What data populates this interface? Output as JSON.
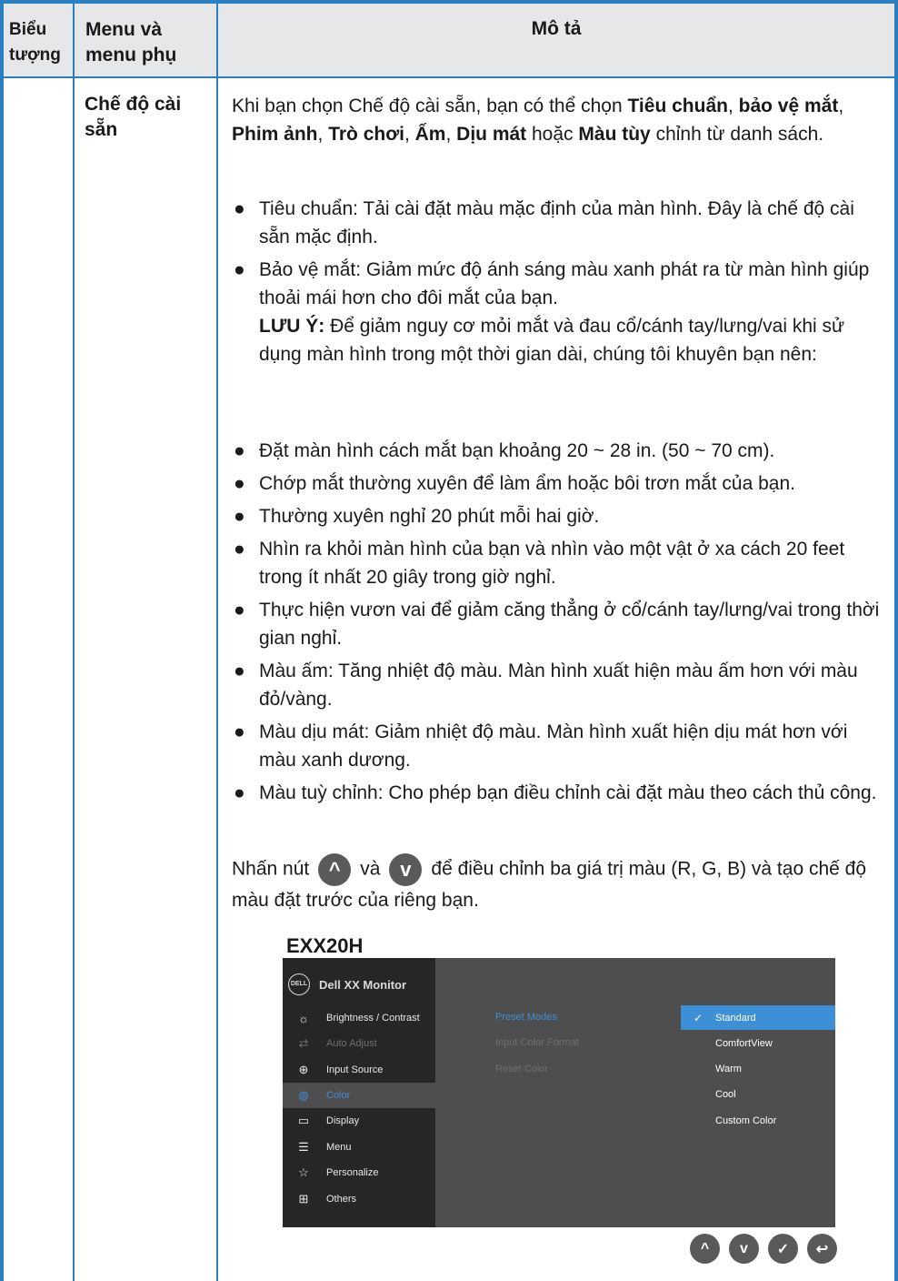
{
  "header": {
    "icon_col": "Biểu tượng",
    "menu_col": "Menu và menu phụ",
    "desc_col": "Mô tả"
  },
  "row": {
    "menu_name": "Chế độ cài sẵn",
    "intro": {
      "p1": "Khi bạn chọn Chế độ cài sẵn, bạn có thể chọn ",
      "b1": "Tiêu chuẩn",
      "p2": ", ",
      "b2": "bảo vệ mắt",
      "p3": ", ",
      "b3": "Phim ảnh",
      "p4": ", ",
      "b4": "Trò chơi",
      "p5": ", ",
      "b5": "Ấm",
      "p6": ", ",
      "b6": "Dịu mát",
      "p7": " hoặc ",
      "b7": "Màu tùy",
      "p8": " chỉnh từ danh sách."
    },
    "bullets_a": [
      "Tiêu chuẩn: Tải cài đặt màu mặc định của màn hình. Đây là chế độ cài sẵn mặc định.",
      "Bảo vệ mắt: Giảm mức độ ánh sáng màu xanh phát ra từ màn hình giúp thoải mái hơn cho đôi mắt của bạn."
    ],
    "note_label": "LƯU Ý:",
    "note_text": " Để giảm nguy cơ mỏi mắt và đau cổ/cánh tay/lưng/vai khi sử dụng màn hình trong một thời gian dài, chúng tôi khuyên bạn nên:",
    "bullets_b": [
      "Đặt màn hình cách mắt bạn khoảng 20 ~ 28 in. (50 ~ 70 cm).",
      "Chớp mắt thường xuyên để làm ẩm hoặc bôi trơn mắt của bạn.",
      "Thường xuyên nghỉ 20 phút mỗi hai giờ.",
      "Nhìn ra khỏi màn hình của bạn và nhìn vào một vật ở xa cách 20 feet trong ít nhất 20 giây trong giờ nghỉ.",
      "Thực hiện vươn vai để giảm căng thẳng ở cổ/cánh tay/lưng/vai trong thời gian nghỉ.",
      "Màu ấm: Tăng nhiệt độ màu. Màn hình xuất hiện màu ấm hơn với màu đỏ/vàng.",
      "Màu dịu mát: Giảm nhiệt độ màu. Màn hình xuất hiện dịu mát hơn với màu xanh dương.",
      "Màu tuỳ chỉnh: Cho phép bạn điều chỉnh cài đặt màu theo cách thủ công."
    ],
    "press": {
      "before": "Nhấn nút",
      "mid": "và",
      "after": "để điều chỉnh ba giá trị màu (R, G, B) và tạo chế độ màu đặt trước của riêng bạn."
    }
  },
  "osd": {
    "model": "EXX20H",
    "logo_text": "DELL",
    "brand": "Dell XX Monitor",
    "menu": [
      {
        "icon": "brightness-icon",
        "glyph": "☼",
        "label": "Brightness / Contrast",
        "state": "normal"
      },
      {
        "icon": "auto-adjust-icon",
        "glyph": "⇄",
        "label": "Auto Adjust",
        "state": "disabled"
      },
      {
        "icon": "input-source-icon",
        "glyph": "⊕",
        "label": "Input Source",
        "state": "normal"
      },
      {
        "icon": "color-icon",
        "glyph": "◍",
        "label": "Color",
        "state": "active"
      },
      {
        "icon": "display-icon",
        "glyph": "▭",
        "label": "Display",
        "state": "normal"
      },
      {
        "icon": "menu-icon",
        "glyph": "☰",
        "label": "Menu",
        "state": "normal"
      },
      {
        "icon": "personalize-icon",
        "glyph": "☆",
        "label": "Personalize",
        "state": "normal"
      },
      {
        "icon": "others-icon",
        "glyph": "⊞",
        "label": "Others",
        "state": "normal"
      }
    ],
    "submenu": [
      "Preset Modes",
      "Input Color Format",
      "Reset Color"
    ],
    "options": [
      "Standard",
      "ComfortView",
      "Warm",
      "Cool",
      "Custom Color"
    ],
    "selected_option": "Standard",
    "nav": [
      {
        "icon": "up-icon",
        "glyph": "^"
      },
      {
        "icon": "down-icon",
        "glyph": "v"
      },
      {
        "icon": "check-icon",
        "glyph": "✓"
      },
      {
        "icon": "back-icon",
        "glyph": "↩"
      }
    ]
  },
  "colors": {
    "border": "#2b7fc0",
    "header_bg": "#e6e7e8",
    "osd_accent": "#3d8fd6"
  }
}
